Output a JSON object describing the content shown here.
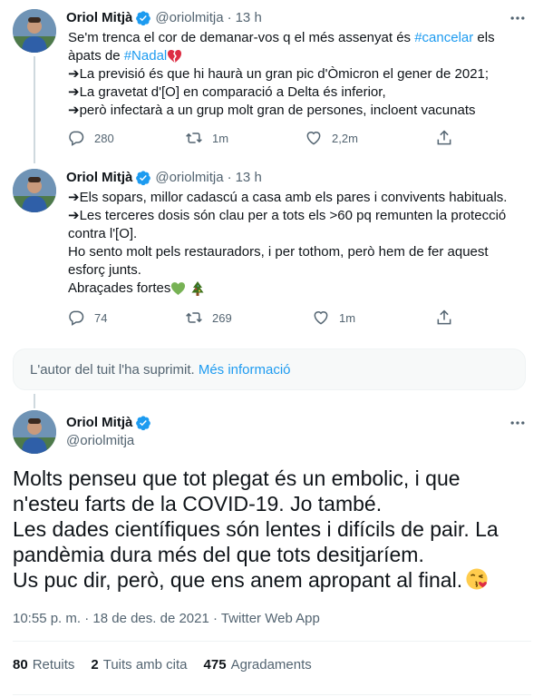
{
  "tweet1": {
    "name": "Oriol Mitjà",
    "handle": "@oriolmitja",
    "dot": "·",
    "time": "13 h",
    "text_parts": [
      "Se'm trenca el cor de demanar-vos q el més assenyat és ",
      "#cancelar",
      " els\nàpats de ",
      "#Nadal",
      "\n➔La previsió és que hi haurà un gran pic d'Òmicron el gener de 2021;\n➔La gravetat d'[O] en comparació a Delta és inferior,\n➔però infectarà a un grup molt gran de persones, incloent vacunats"
    ],
    "replies": "280",
    "retweets": "1m",
    "likes": "2,2m"
  },
  "tweet2": {
    "name": "Oriol Mitjà",
    "handle": "@oriolmitja",
    "dot": "·",
    "time": "13 h",
    "text": "➔Els sopars, millor cadascú a casa amb els pares i convivents habituals.\n➔Les terceres dosis són clau per a tots els >60 pq remunten la protecció\ncontra l'[O].\nHo sento molt pels restauradors, i per tothom, però hem de fer aquest\nesforç junts.\nAbraçades fortes",
    "replies": "74",
    "retweets": "269",
    "likes": "1m"
  },
  "deleted_notice": {
    "text": "L'autor del tuit l'ha suprimit.",
    "link": "Més informació"
  },
  "main_tweet": {
    "name": "Oriol Mitjà",
    "handle": "@oriolmitja",
    "text": "Molts penseu que tot plegat és un embolic, i que\nn'esteu farts de la COVID-19. Jo també.\nLes dades científiques són lentes i difícils de pair. La\npandèmia dura més del que tots desitjaríem.\nUs puc dir, però, que ens anem apropant al final.",
    "timestamp": "10:55 p. m. · 18 de des. de 2021 · Twitter Web App",
    "stats": [
      {
        "count": "80",
        "label": "Retuits"
      },
      {
        "count": "2",
        "label": "Tuits amb cita"
      },
      {
        "count": "475",
        "label": "Agradaments"
      }
    ]
  },
  "colors": {
    "accent": "#1d9bf0",
    "muted": "#536471",
    "text": "#0f1419",
    "heart_red": "#e0245e",
    "green_heart": "#77b255"
  }
}
